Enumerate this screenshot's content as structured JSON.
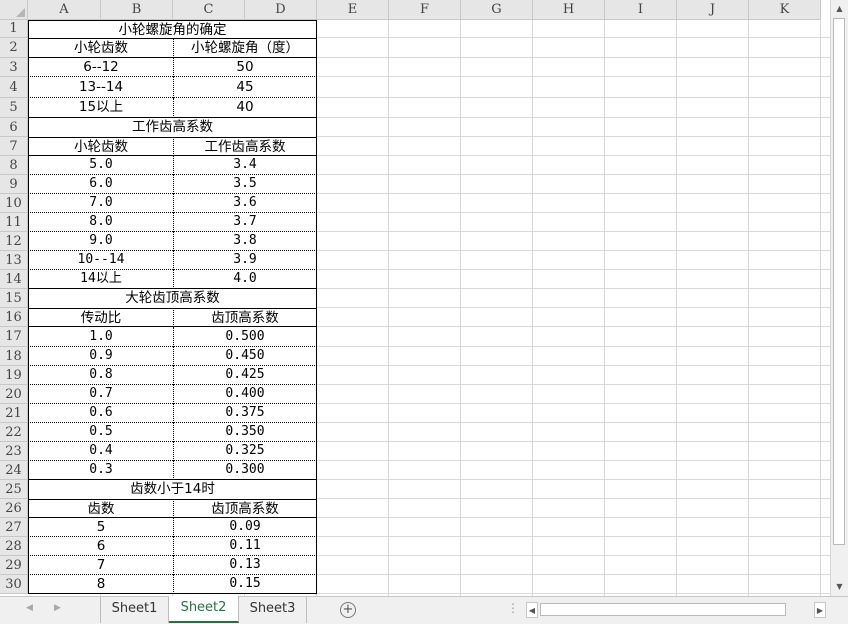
{
  "columns": [
    "A",
    "B",
    "C",
    "D",
    "E",
    "F",
    "G",
    "H",
    "I",
    "J",
    "K"
  ],
  "rows": [
    "1",
    "2",
    "3",
    "4",
    "5",
    "6",
    "7",
    "8",
    "9",
    "10",
    "11",
    "12",
    "13",
    "14",
    "15",
    "16",
    "17",
    "18",
    "19",
    "20",
    "21",
    "22",
    "23",
    "24",
    "25",
    "26",
    "27",
    "28",
    "29",
    "30"
  ],
  "tables": [
    {
      "title": "小轮螺旋角的确定",
      "headers": [
        "小轮齿数",
        "小轮螺旋角（度）"
      ],
      "rows": [
        [
          "6--12",
          "50"
        ],
        [
          "13--14",
          "45"
        ],
        [
          "15以上",
          "40"
        ]
      ]
    },
    {
      "title": "工作齿高系数",
      "headers": [
        "小轮齿数",
        "工作齿高系数"
      ],
      "rows": [
        [
          "5.0",
          "3.4"
        ],
        [
          "6.0",
          "3.5"
        ],
        [
          "7.0",
          "3.6"
        ],
        [
          "8.0",
          "3.7"
        ],
        [
          "9.0",
          "3.8"
        ],
        [
          "10--14",
          "3.9"
        ],
        [
          "14以上",
          "4.0"
        ]
      ]
    },
    {
      "title": "大轮齿顶高系数",
      "headers": [
        "传动比",
        "齿顶高系数"
      ],
      "rows": [
        [
          "1.0",
          "0.500"
        ],
        [
          "0.9",
          "0.450"
        ],
        [
          "0.8",
          "0.425"
        ],
        [
          "0.7",
          "0.400"
        ],
        [
          "0.6",
          "0.375"
        ],
        [
          "0.5",
          "0.350"
        ],
        [
          "0.4",
          "0.325"
        ],
        [
          "0.3",
          "0.300"
        ]
      ]
    },
    {
      "title": "齿数小于14时",
      "headers": [
        "齿数",
        "齿顶高系数"
      ],
      "rows": [
        [
          "5",
          "0.09"
        ],
        [
          "6",
          "0.11"
        ],
        [
          "7",
          "0.13"
        ],
        [
          "8",
          "0.15"
        ]
      ]
    }
  ],
  "sheets": [
    "Sheet1",
    "Sheet2",
    "Sheet3"
  ],
  "active_sheet": "Sheet2",
  "add_sheet_label": "+",
  "separator": "⋮",
  "icons": {
    "scroll_up": "up-arrow-icon",
    "scroll_down": "down-arrow-icon",
    "scroll_left": "left-arrow-icon",
    "scroll_right": "right-arrow-icon",
    "sheet_nav_prev": "chevron-left-icon",
    "sheet_nav_next": "chevron-right-icon"
  },
  "colors": {
    "active_tab": "#217346",
    "header_bg": "#e6e6e6",
    "gridline": "#dadada"
  }
}
